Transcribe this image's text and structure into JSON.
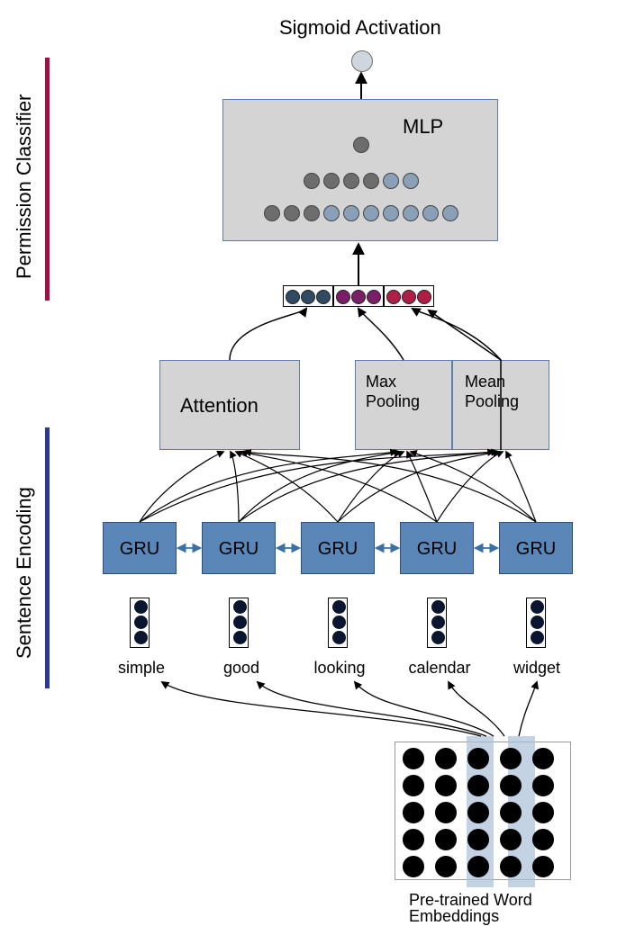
{
  "section_labels": {
    "classifier": "Permission Classifier",
    "encoder": "Sentence Encoding"
  },
  "top_label": "Sigmoid Activation",
  "mlp_label": "MLP",
  "attention_label": "Attention",
  "maxpool_label_l1": "Max",
  "maxpool_label_l2": "Pooling",
  "meanpool_label_l1": "Mean",
  "meanpool_label_l2": "Pooling",
  "gru_label": "GRU",
  "words": [
    "simple",
    "good",
    "looking",
    "calendar",
    "widget"
  ],
  "embeddings_label_l1": "Pre-trained Word",
  "embeddings_label_l2": "Embeddings",
  "colors": {
    "gru_fill": "#5b87b8",
    "box_fill": "#d4d4d4",
    "bar_classifier": "#a0113f",
    "bar_encoder": "#2a3b8f",
    "feat_attn": "#2f4a63",
    "feat_max": "#7a1e68",
    "feat_mean": "#b01e45",
    "mlp_gray": "#6d6d6d",
    "mlp_blue": "#8aa0b8"
  },
  "chart_data": {
    "type": "diagram",
    "title": "Neural permission classifier architecture",
    "components": [
      {
        "name": "Pre-trained Word Embeddings",
        "grid": "5x5 black circles, 2 highlighted columns"
      },
      {
        "name": "word tokens",
        "values": [
          "simple",
          "good",
          "looking",
          "calendar",
          "widget"
        ]
      },
      {
        "name": "word vectors",
        "repr": "3-element column vectors per token"
      },
      {
        "name": "GRU",
        "count": 5,
        "connection": "bidirectional between neighbours"
      },
      {
        "name": "Attention",
        "inputs": "all GRU states"
      },
      {
        "name": "Max Pooling",
        "inputs": "all GRU states"
      },
      {
        "name": "Mean Pooling",
        "inputs": "all GRU states"
      },
      {
        "name": "feature concat",
        "repr": "3 groups of 3 circles (attention / max / mean)"
      },
      {
        "name": "MLP",
        "layers": [
          10,
          6,
          1
        ]
      },
      {
        "name": "Sigmoid Activation",
        "outputs": 1
      }
    ],
    "flow": [
      "Pre-trained Word Embeddings → word tokens",
      "word tokens → word vectors",
      "word vectors → GRU units",
      "GRU units ↔ neighbours (bidirectional)",
      "GRU units → Attention / Max Pooling / Mean Pooling",
      "Attention+Max+Mean → feature concat",
      "feature concat → MLP",
      "MLP → Sigmoid Activation"
    ]
  }
}
